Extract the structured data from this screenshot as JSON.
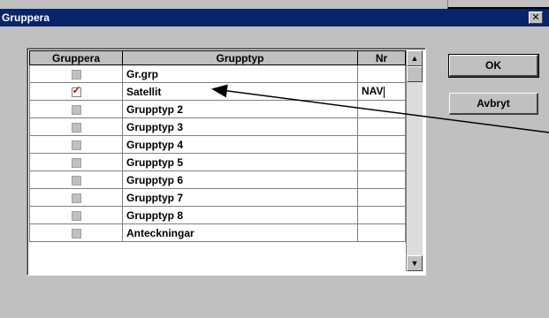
{
  "window": {
    "title": "Gruppera",
    "close_glyph": "✕"
  },
  "table": {
    "headers": {
      "group": "Gruppera",
      "type": "Grupptyp",
      "nr": "Nr"
    },
    "rows": [
      {
        "checked": false,
        "type": "Gr.grp",
        "nr": ""
      },
      {
        "checked": true,
        "type": "Satellit",
        "nr": "NAV"
      },
      {
        "checked": false,
        "type": "Grupptyp 2",
        "nr": ""
      },
      {
        "checked": false,
        "type": "Grupptyp 3",
        "nr": ""
      },
      {
        "checked": false,
        "type": "Grupptyp 4",
        "nr": ""
      },
      {
        "checked": false,
        "type": "Grupptyp 5",
        "nr": ""
      },
      {
        "checked": false,
        "type": "Grupptyp 6",
        "nr": ""
      },
      {
        "checked": false,
        "type": "Grupptyp 7",
        "nr": ""
      },
      {
        "checked": false,
        "type": "Grupptyp 8",
        "nr": ""
      },
      {
        "checked": false,
        "type": "Anteckningar",
        "nr": ""
      }
    ]
  },
  "buttons": {
    "ok": "OK",
    "cancel": "Avbryt"
  },
  "scrollbar": {
    "up_glyph": "▲",
    "down_glyph": "▼"
  },
  "colors": {
    "titlebar": "#0a246a",
    "checkmark": "#d00000"
  }
}
